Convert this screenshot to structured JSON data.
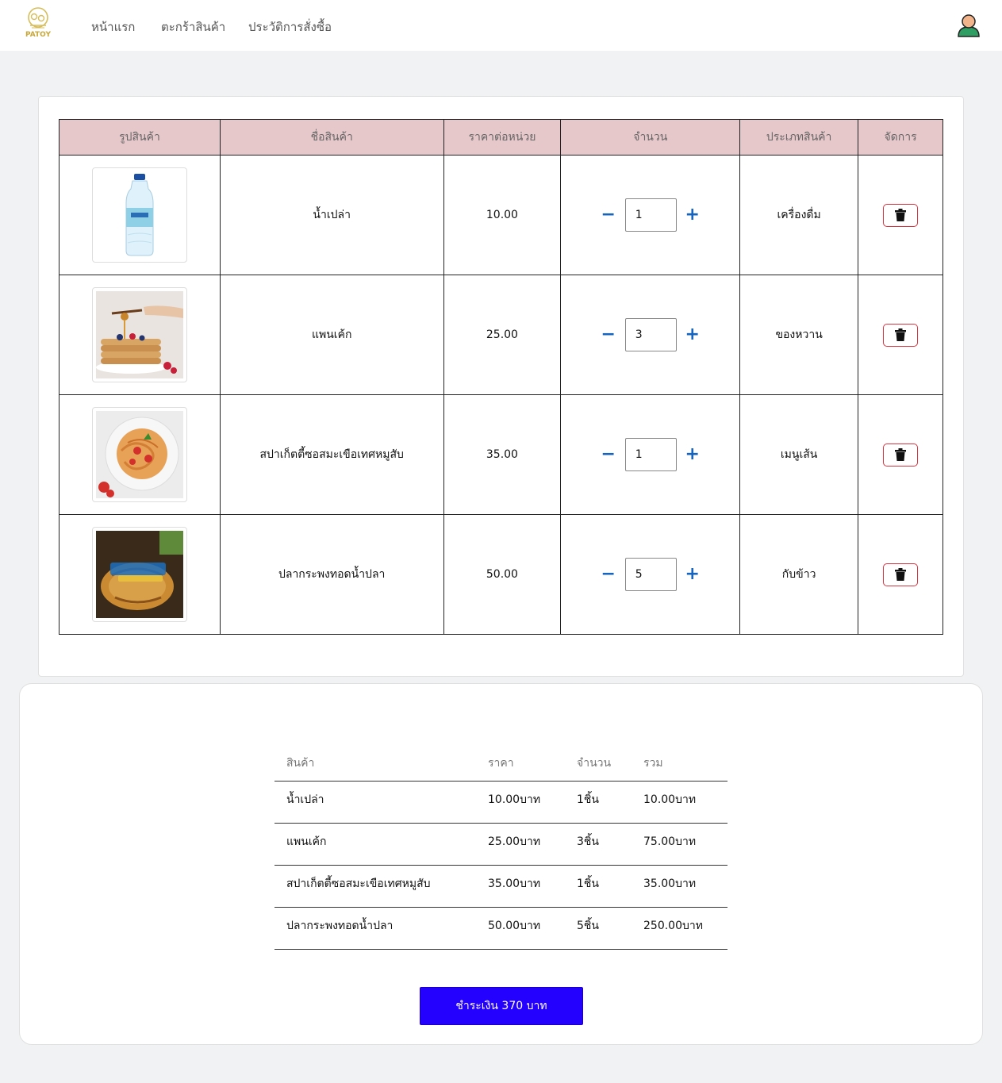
{
  "nav": {
    "logo_text": "PATOY",
    "links": [
      "หน้าแรก",
      "ตะกร้าสินค้า",
      "ประวัติการสั่งซื้อ"
    ]
  },
  "cart": {
    "headers": [
      "รูปสินค้า",
      "ชื่อสินค้า",
      "ราคาต่อหน่วย",
      "จำนวน",
      "ประเภทสินค้า",
      "จัดการ"
    ],
    "rows": [
      {
        "name": "น้ำเปล่า",
        "price": "10.00",
        "qty": "1",
        "category": "เครื่องดื่ม",
        "image": "water-bottle"
      },
      {
        "name": "แพนเค้ก",
        "price": "25.00",
        "qty": "3",
        "category": "ของหวาน",
        "image": "pancake"
      },
      {
        "name": "สปาเก็ตตี้ซอสมะเขือเทศหมูสับ",
        "price": "35.00",
        "qty": "1",
        "category": "เมนูเส้น",
        "image": "spaghetti"
      },
      {
        "name": "ปลากระพงทอดน้ำปลา",
        "price": "50.00",
        "qty": "5",
        "category": "กับข้าว",
        "image": "fried-fish"
      }
    ]
  },
  "summary": {
    "headers": [
      "สินค้า",
      "ราคา",
      "จำนวน",
      "รวม"
    ],
    "rows": [
      [
        "น้ำเปล่า",
        "10.00บาท",
        "1ชิ้น",
        "10.00บาท"
      ],
      [
        "แพนเค้ก",
        "25.00บาท",
        "3ชิ้น",
        "75.00บาท"
      ],
      [
        "สปาเก็ตตี้ซอสมะเขือเทศหมูสับ",
        "35.00บาท",
        "1ชิ้น",
        "35.00บาท"
      ],
      [
        "ปลากระพงทอดน้ำปลา",
        "50.00บาท",
        "5ชิ้น",
        "250.00บาท"
      ]
    ],
    "pay_label": "ชำระเงิน 370 บาท"
  },
  "colors": {
    "header_bg": "#e6c7ca",
    "pay_button": "#2400ff",
    "delete_border": "#d9343f",
    "qty_control": "#1564c0"
  }
}
